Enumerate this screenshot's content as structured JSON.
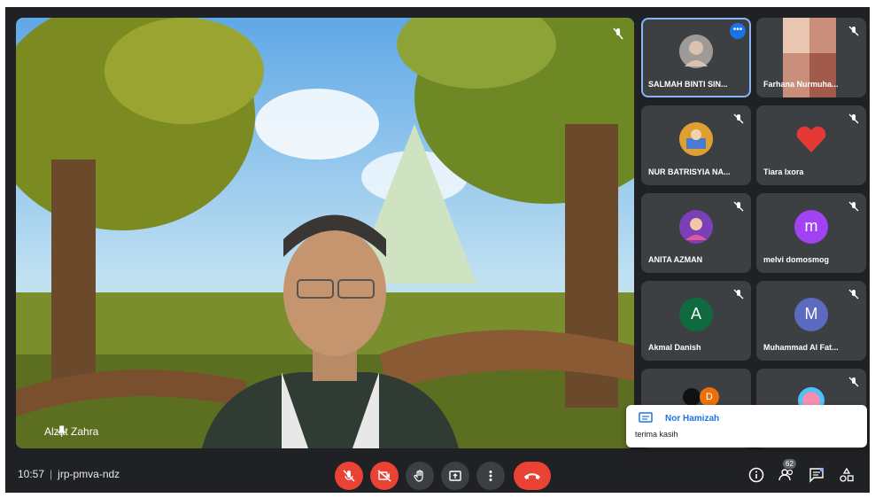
{
  "stage": {
    "speaker_name": "Alzat Zahra"
  },
  "tiles": [
    {
      "name": "SALMAH BINTI SIN...",
      "avatar_type": "photo"
    },
    {
      "name": "Farhana Nurmuha...",
      "avatar_type": "photo"
    },
    {
      "name": "NUR BATRISYIA NA...",
      "avatar_type": "photo"
    },
    {
      "name": "Tiara Ixora",
      "avatar_type": "heart"
    },
    {
      "name": "ANITA AZMAN",
      "avatar_type": "photo"
    },
    {
      "name": "melvi domosmog",
      "avatar_letter": "m",
      "avatar_color": "#a142f4"
    },
    {
      "name": "Akmal Danish",
      "avatar_letter": "A",
      "avatar_color": "#0f6b3f"
    },
    {
      "name": "Muhammad Al Fat...",
      "avatar_letter": "M",
      "avatar_color": "#5c6bc0"
    },
    {
      "name": "",
      "avatar_letter": "D",
      "avatar_color": "#e8710a"
    },
    {
      "name": "",
      "avatar_type": "photo"
    }
  ],
  "chat_popup": {
    "sender": "Nor Hamizah",
    "message": "terima kasih"
  },
  "bottom_bar": {
    "time": "10:57",
    "meeting_code": "jrp-pmva-ndz",
    "people_count": "62"
  },
  "colors": {
    "background": "#202124",
    "tile": "#3c4043",
    "danger": "#ea4335",
    "accent": "#1a73e8"
  },
  "icons": {
    "mic_off": "mic-off-icon",
    "cam_off": "camera-off-icon",
    "raise_hand": "raise-hand-icon",
    "present": "present-screen-icon",
    "more": "more-options-icon",
    "end_call": "end-call-icon",
    "info": "info-icon",
    "people": "people-icon",
    "chat": "chat-icon",
    "activities": "activities-icon"
  }
}
